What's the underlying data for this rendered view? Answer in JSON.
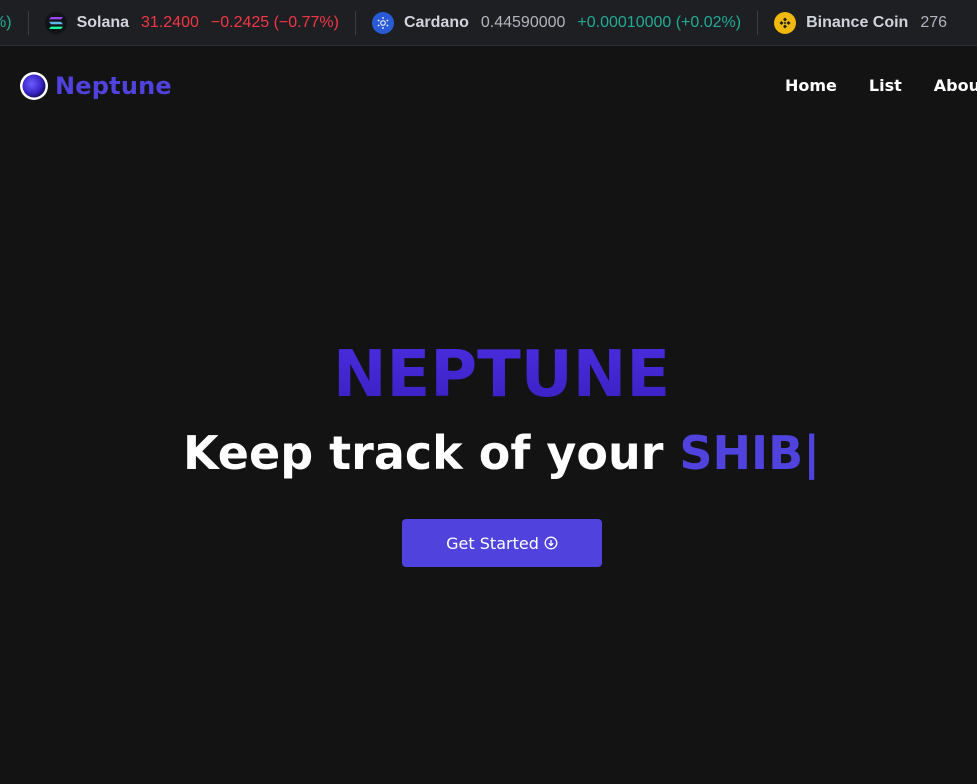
{
  "ticker": {
    "lead_fragment": "%)",
    "items": [
      {
        "name": "Solana",
        "price": "31.2400",
        "change": "−0.2425 (−0.77%)",
        "icon": "solana-icon",
        "direction": "down"
      },
      {
        "name": "Cardano",
        "price": "0.44590000",
        "change": "+0.00010000 (+0.02%)",
        "icon": "cardano-icon",
        "direction": "up"
      },
      {
        "name": "Binance Coin",
        "price": "276",
        "change": "",
        "icon": "binance-coin-icon",
        "direction": "up"
      }
    ]
  },
  "nav": {
    "brand": "Neptune",
    "links": [
      "Home",
      "List",
      "About"
    ]
  },
  "hero": {
    "title": "NEPTUNE",
    "subtitle_prefix": "Keep track of your",
    "typed_word": "SHIB",
    "caret": "|",
    "cta_label": "Get Started"
  },
  "colors": {
    "background": "#131313",
    "ticker_background": "#1e1f23",
    "accent": "#4f42dd",
    "title": "#3f22c9",
    "negative": "#f23645",
    "positive": "#22ab94"
  }
}
